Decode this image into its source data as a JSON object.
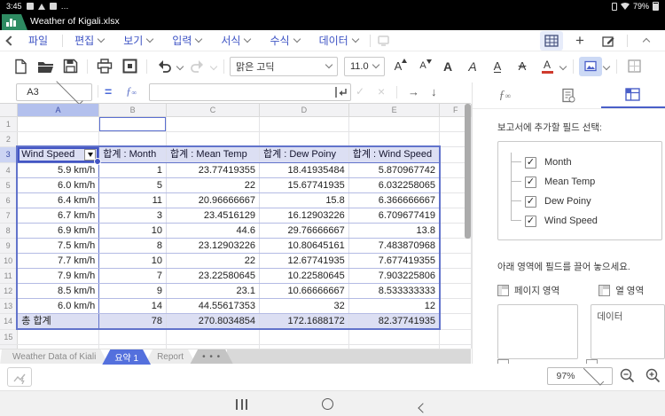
{
  "status_bar": {
    "time": "3:45",
    "overflow": "…",
    "battery_percent": "79%"
  },
  "title_bar": {
    "title": "Weather of Kigali.xlsx"
  },
  "menu": {
    "file_label": "파일",
    "items": [
      "편집",
      "보기",
      "입력",
      "서식",
      "수식",
      "데이터"
    ]
  },
  "toolbar": {
    "font_name": "맑은 고딕",
    "font_size": "11.0"
  },
  "formula_bar": {
    "cell_ref": "A3",
    "formula_value": "",
    "equals": "=",
    "check": "✓",
    "cancel": "×",
    "arrow_right": "→",
    "arrow_down": "↓"
  },
  "grid": {
    "col_headers": [
      "A",
      "B",
      "C",
      "D",
      "E",
      "F"
    ],
    "row_count": 16,
    "selected_cell": "A3",
    "pivot": {
      "filter_label": "Wind Speed",
      "headers": [
        "합계 : Month",
        "합계 : Mean Temp",
        "합계 : Dew Poiny",
        "합계 : Wind Speed"
      ],
      "rows": [
        [
          "5.9 km/h",
          "1",
          "23.77419355",
          "18.41935484",
          "5.870967742"
        ],
        [
          "6.0 km/h",
          "5",
          "22",
          "15.67741935",
          "6.032258065"
        ],
        [
          "6.4 km/h",
          "11",
          "20.96666667",
          "15.8",
          "6.366666667"
        ],
        [
          "6.7 km/h",
          "3",
          "23.4516129",
          "16.12903226",
          "6.709677419"
        ],
        [
          "6.9 km/h",
          "10",
          "44.6",
          "29.76666667",
          "13.8"
        ],
        [
          "7.5 km/h",
          "8",
          "23.12903226",
          "10.80645161",
          "7.483870968"
        ],
        [
          "7.7 km/h",
          "10",
          "22",
          "12.67741935",
          "7.677419355"
        ],
        [
          "7.9 km/h",
          "7",
          "23.22580645",
          "10.22580645",
          "7.903225806"
        ],
        [
          "8.5 km/h",
          "9",
          "23.1",
          "10.66666667",
          "8.533333333"
        ],
        [
          "6.0 km/h",
          "14",
          "44.55617353",
          "32",
          "12"
        ]
      ],
      "total_row": [
        "총 합계",
        "78",
        "270.8034854",
        "172.1688172",
        "82.37741935"
      ]
    }
  },
  "panel": {
    "select_fields_label": "보고서에 추가할 필드 선택:",
    "fields": [
      {
        "label": "Month",
        "checked": true
      },
      {
        "label": "Mean Temp",
        "checked": true
      },
      {
        "label": "Dew Poiny",
        "checked": true
      },
      {
        "label": "Wind Speed",
        "checked": true
      }
    ],
    "drag_hint": "아래 영역에 필드를 끌어 놓으세요.",
    "page_area_label": "페이지 영역",
    "column_area_label": "열 영역",
    "column_area_content": "데이터"
  },
  "sheet_tabs": [
    {
      "label": "Weather Data of Kiali",
      "active": false,
      "more": false
    },
    {
      "label": "요약 1",
      "active": true,
      "more": false
    },
    {
      "label": "Report",
      "active": false,
      "more": false
    },
    {
      "label": "• • •",
      "active": false,
      "more": true
    }
  ],
  "zoom_control": {
    "level": "97%"
  },
  "colors": {
    "accent_blue": "#4a5fc8",
    "pivot_fill": "#dcdff3",
    "active_tab_blue": "#5470dd",
    "doc_green": "#2e8b62",
    "font_color_red": "#cf3a2d"
  }
}
